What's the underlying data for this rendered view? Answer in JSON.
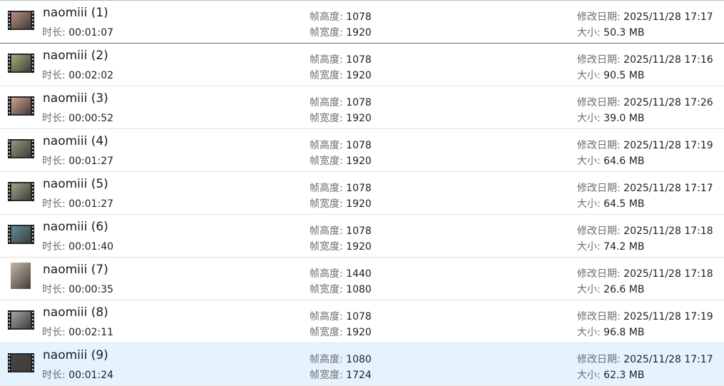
{
  "labels": {
    "duration": "时长:",
    "frame_height": "帧高度:",
    "frame_width": "帧宽度:",
    "modified": "修改日期:",
    "size": "大小:"
  },
  "files": [
    {
      "name": "naomiii (1)",
      "duration": "00:01:07",
      "frame_height": "1078",
      "frame_width": "1920",
      "modified": "2025/11/28 17:17",
      "size": "50.3 MB",
      "thumb": "film",
      "thumb_color": "#b98d7c",
      "selected": false
    },
    {
      "name": "naomiii (2)",
      "duration": "00:02:02",
      "frame_height": "1078",
      "frame_width": "1920",
      "modified": "2025/11/28 17:16",
      "size": "90.5 MB",
      "thumb": "film",
      "thumb_color": "#a3b07a",
      "selected": false
    },
    {
      "name": "naomiii (3)",
      "duration": "00:00:52",
      "frame_height": "1078",
      "frame_width": "1920",
      "modified": "2025/11/28 17:26",
      "size": "39.0 MB",
      "thumb": "film",
      "thumb_color": "#d9a08a",
      "selected": false
    },
    {
      "name": "naomiii (4)",
      "duration": "00:01:27",
      "frame_height": "1078",
      "frame_width": "1920",
      "modified": "2025/11/28 17:19",
      "size": "64.6 MB",
      "thumb": "film",
      "thumb_color": "#8f9a7e",
      "selected": false
    },
    {
      "name": "naomiii (5)",
      "duration": "00:01:27",
      "frame_height": "1078",
      "frame_width": "1920",
      "modified": "2025/11/28 17:17",
      "size": "64.5 MB",
      "thumb": "film",
      "thumb_color": "#9ea684",
      "selected": false
    },
    {
      "name": "naomiii (6)",
      "duration": "00:01:40",
      "frame_height": "1078",
      "frame_width": "1920",
      "modified": "2025/11/28 17:18",
      "size": "74.2 MB",
      "thumb": "film",
      "thumb_color": "#5f8f98",
      "selected": false
    },
    {
      "name": "naomiii (7)",
      "duration": "00:00:35",
      "frame_height": "1440",
      "frame_width": "1080",
      "modified": "2025/11/28 17:18",
      "size": "26.6 MB",
      "thumb": "portrait",
      "thumb_color": "#c9b6a6",
      "selected": false
    },
    {
      "name": "naomiii (8)",
      "duration": "00:02:11",
      "frame_height": "1078",
      "frame_width": "1920",
      "modified": "2025/11/28 17:19",
      "size": "96.8 MB",
      "thumb": "film",
      "thumb_color": "#a7a2a8",
      "selected": false
    },
    {
      "name": "naomiii (9)",
      "duration": "00:01:24",
      "frame_height": "1080",
      "frame_width": "1724",
      "modified": "2025/11/28 17:17",
      "size": "62.3 MB",
      "thumb": "film",
      "thumb_color": "#4a4440",
      "selected": true
    }
  ]
}
